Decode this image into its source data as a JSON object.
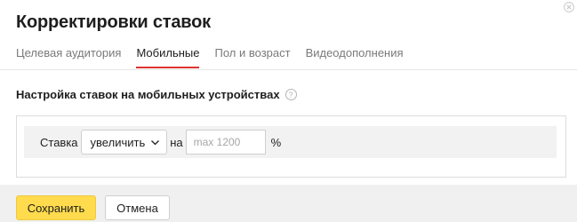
{
  "dialog": {
    "title": "Корректировки ставок",
    "close_icon": "close-icon"
  },
  "tabs": [
    {
      "label": "Целевая аудитория",
      "active": false
    },
    {
      "label": "Мобильные",
      "active": true
    },
    {
      "label": "Пол и возраст",
      "active": false
    },
    {
      "label": "Видеодополнения",
      "active": false
    }
  ],
  "section": {
    "title": "Настройка ставок на мобильных устройствах",
    "help_glyph": "?"
  },
  "bid": {
    "label": "Ставка",
    "mode_value": "увеличить",
    "connector": "на",
    "input_value": "",
    "input_placeholder": "max 1200",
    "unit": "%"
  },
  "footer": {
    "save_label": "Сохранить",
    "cancel_label": "Отмена"
  },
  "colors": {
    "accent_tab": "#e0332e",
    "save_button": "#ffdb4d",
    "footer_bg": "#f0f0f0",
    "row_bg": "#f2f2f2"
  }
}
